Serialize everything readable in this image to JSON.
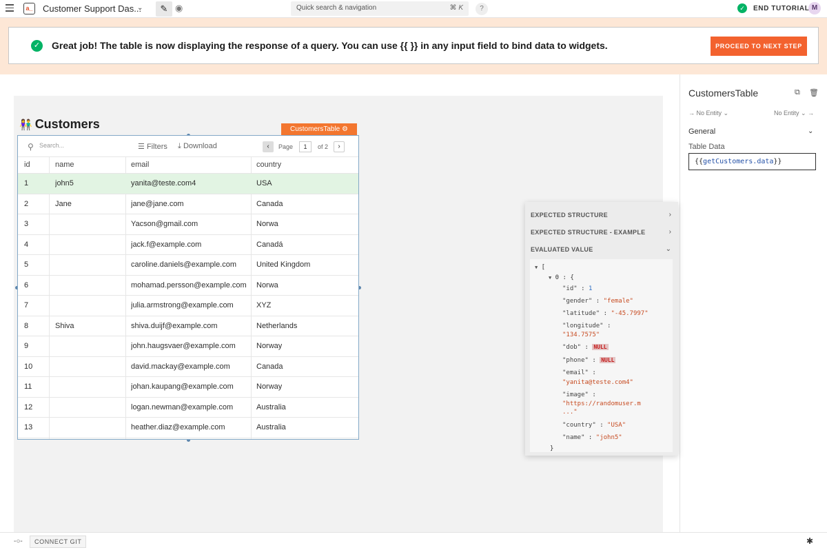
{
  "topbar": {
    "app_name": "Customer Support Das...",
    "search_placeholder": "Quick search & navigation",
    "search_shortcut": "⌘ K",
    "help_label": "?",
    "end_tutorial_label": "END TUTORIAL",
    "avatar_initial": "M"
  },
  "banner": {
    "message": "Great job! The table is now displaying the response of a query. You can use {{ }} in any input field to bind data to widgets.",
    "proceed_label": "PROCEED TO NEXT STEP"
  },
  "canvas": {
    "section_title": "Customers",
    "widget_tag": "CustomersTable"
  },
  "table": {
    "search_placeholder": "Search...",
    "filters_label": "Filters",
    "download_label": "Download",
    "page_label": "Page",
    "current_page": "1",
    "page_of": "of 2",
    "columns": [
      "id",
      "name",
      "email",
      "country"
    ],
    "rows": [
      [
        "1",
        "john5",
        "yanita@teste.com4",
        "USA"
      ],
      [
        "2",
        "Jane",
        "jane@jane.com",
        "Canada"
      ],
      [
        "3",
        "",
        "Yacson@gmail.com",
        "Norwa"
      ],
      [
        "4",
        "",
        "jack.f@example.com",
        "Canadá"
      ],
      [
        "5",
        "",
        "caroline.daniels@example.com",
        "United Kingdom"
      ],
      [
        "6",
        "",
        "mohamad.persson@example.com",
        "Norwa"
      ],
      [
        "7",
        "",
        "julia.armstrong@example.com",
        "XYZ"
      ],
      [
        "8",
        "Shiva",
        "shiva.duijf@example.com",
        "Netherlands"
      ],
      [
        "9",
        "",
        "john.haugsvaer@example.com",
        "Norway"
      ],
      [
        "10",
        "",
        "david.mackay@example.com",
        "Canada"
      ],
      [
        "11",
        "",
        "johan.kaupang@example.com",
        "Norway"
      ],
      [
        "12",
        "",
        "logan.newman@example.com",
        "Australia"
      ],
      [
        "13",
        "",
        "heather.diaz@example.com",
        "Australia"
      ]
    ]
  },
  "property_pane": {
    "widget_name": "CustomersTable",
    "entity_left": "No Entity",
    "entity_right": "No Entity",
    "section_general": "General",
    "table_data_label": "Table Data",
    "table_data_open": "{{",
    "table_data_expr": "getCustomers.data",
    "table_data_close": "}}"
  },
  "eval_popup": {
    "expected_structure": "EXPECTED STRUCTURE",
    "expected_structure_example": "EXPECTED STRUCTURE - EXAMPLE",
    "evaluated_value": "EVALUATED VALUE",
    "json": {
      "open_bracket": "[",
      "index_open": "0 : {",
      "id_key": "\"id\"",
      "id_val": "1",
      "gender_key": "\"gender\"",
      "gender_val": "\"female\"",
      "latitude_key": "\"latitude\"",
      "latitude_val": "\"-45.7997\"",
      "longitude_key": "\"longitude\"",
      "longitude_val": "\"134.7575\"",
      "dob_key": "\"dob\"",
      "dob_val": "NULL",
      "phone_key": "\"phone\"",
      "phone_val": "NULL",
      "email_key": "\"email\"",
      "email_val": "\"yanita@teste.com4\"",
      "image_key": "\"image\"",
      "image_val": "\"https://randomuser.m",
      "image_ellipsis": "...\"",
      "country_key": "\"country\"",
      "country_val": "\"USA\"",
      "name_key": "\"name\"",
      "name_val": "\"john5\"",
      "close_brace": "}"
    }
  },
  "bottombar": {
    "connect_git_label": "CONNECT GIT"
  }
}
